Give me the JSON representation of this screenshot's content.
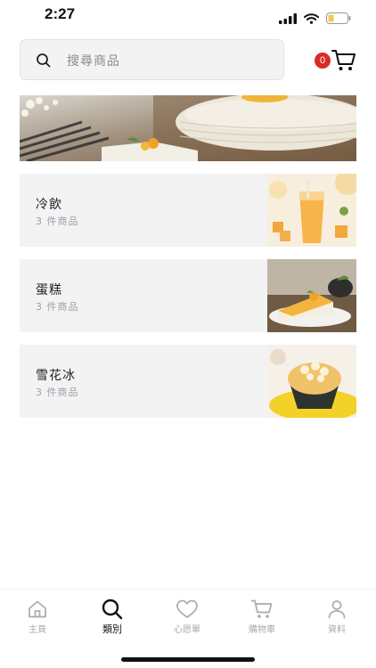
{
  "status": {
    "time": "2:27"
  },
  "search": {
    "placeholder": "搜尋商品"
  },
  "cart": {
    "count": "0"
  },
  "categories": [
    {
      "name": "冷飲",
      "count": "3 件商品",
      "thumb": "mango-drink"
    },
    {
      "name": "蛋糕",
      "count": "3 件商品",
      "thumb": "mango-cake"
    },
    {
      "name": "雪花冰",
      "count": "3 件商品",
      "thumb": "mango-shaved-ice"
    }
  ],
  "tabs": [
    {
      "label": "主頁",
      "icon": "home-icon",
      "active": false
    },
    {
      "label": "類別",
      "icon": "search-icon",
      "active": true
    },
    {
      "label": "心愿單",
      "icon": "heart-icon",
      "active": false
    },
    {
      "label": "購物車",
      "icon": "cart-icon",
      "active": false
    },
    {
      "label": "資料",
      "icon": "user-icon",
      "active": false
    }
  ],
  "colors": {
    "accent": "#111111",
    "badge": "#d92c26",
    "inactive": "#aaaaaa",
    "card": "#f3f3f3"
  }
}
